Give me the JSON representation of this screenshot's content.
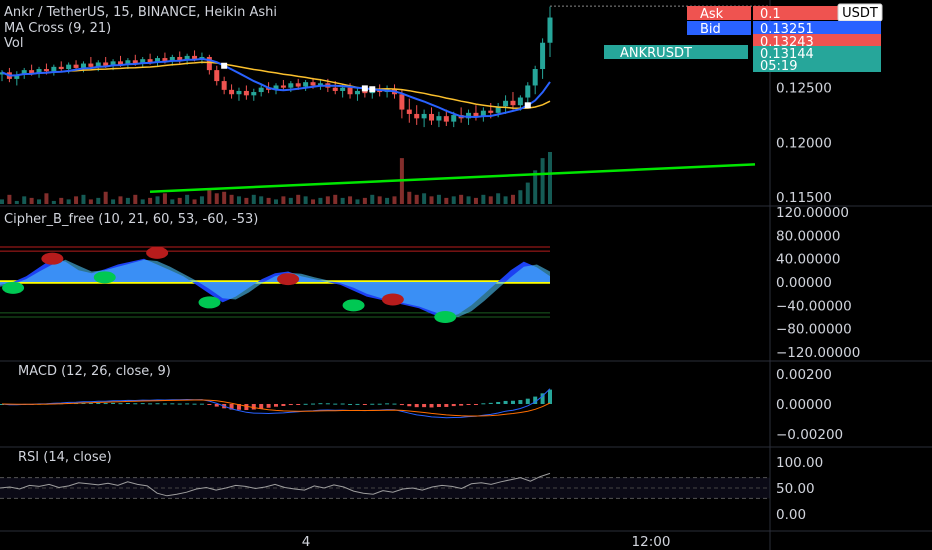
{
  "header": {
    "title": "Ankr / TetherUS, 15, BINANCE, Heikin Ashi",
    "ma_label": "MA Cross (9, 21)",
    "vol_label": "Vol"
  },
  "price_tags": {
    "ask_label": "Ask",
    "ask_value": "0.1",
    "bid_label": "Bid",
    "bid_value": "0.13251",
    "third_value": "0.13243",
    "symbol": "ANKRUSDT",
    "last_price": "0.13144",
    "countdown": "05:19",
    "currency_button": "USDT"
  },
  "colors": {
    "up": "#26a69a",
    "down": "#ef5350",
    "ma_fast": "#2962ff",
    "ma_slow": "#fbc02d",
    "trendline": "#00e600",
    "cipher_fill_yellow": "#ffff00",
    "cipher_fill_blue": "#1e44ff",
    "dot_red": "#b71c1c",
    "dot_green": "#00c853"
  },
  "chart_data": [
    {
      "type": "candlestick",
      "title": "Ankr / TetherUS, 15, BINANCE, Heikin Ashi",
      "y_ticks": [
        "0.12500",
        "0.12000",
        "0.11500"
      ],
      "ylim": [
        0.1142,
        0.133
      ],
      "x_ticks": [
        "4",
        "12:00"
      ],
      "candles": [
        [
          0.1262,
          0.1266,
          0.1256,
          0.1264
        ],
        [
          0.1264,
          0.1268,
          0.1255,
          0.1258
        ],
        [
          0.1258,
          0.1265,
          0.1252,
          0.1262
        ],
        [
          0.1262,
          0.1268,
          0.1258,
          0.1266
        ],
        [
          0.1266,
          0.1271,
          0.1261,
          0.1263
        ],
        [
          0.1263,
          0.1269,
          0.1259,
          0.1267
        ],
        [
          0.1267,
          0.1272,
          0.1262,
          0.1265
        ],
        [
          0.1265,
          0.1271,
          0.1261,
          0.1269
        ],
        [
          0.1269,
          0.1274,
          0.1264,
          0.1267
        ],
        [
          0.1267,
          0.1273,
          0.1263,
          0.1271
        ],
        [
          0.1271,
          0.1275,
          0.1265,
          0.1268
        ],
        [
          0.1268,
          0.1274,
          0.1264,
          0.1272
        ],
        [
          0.1272,
          0.1278,
          0.1266,
          0.1269
        ],
        [
          0.1269,
          0.1275,
          0.1265,
          0.1273
        ],
        [
          0.1273,
          0.1278,
          0.1268,
          0.127
        ],
        [
          0.127,
          0.1276,
          0.1266,
          0.1274
        ],
        [
          0.1274,
          0.1279,
          0.1269,
          0.1271
        ],
        [
          0.1271,
          0.1277,
          0.1267,
          0.1275
        ],
        [
          0.1275,
          0.128,
          0.127,
          0.1272
        ],
        [
          0.1272,
          0.1278,
          0.1268,
          0.1276
        ],
        [
          0.1276,
          0.1281,
          0.1271,
          0.1273
        ],
        [
          0.1273,
          0.1279,
          0.1269,
          0.1277
        ],
        [
          0.1277,
          0.1282,
          0.1272,
          0.1274
        ],
        [
          0.1274,
          0.128,
          0.127,
          0.1278
        ],
        [
          0.1278,
          0.1283,
          0.1272,
          0.1275
        ],
        [
          0.1275,
          0.1281,
          0.1271,
          0.1279
        ],
        [
          0.1279,
          0.1284,
          0.1274,
          0.1276
        ],
        [
          0.1276,
          0.1282,
          0.1272,
          0.1278
        ],
        [
          0.1278,
          0.128,
          0.1262,
          0.1266
        ],
        [
          0.1266,
          0.127,
          0.1252,
          0.1256
        ],
        [
          0.1256,
          0.126,
          0.1244,
          0.1248
        ],
        [
          0.1248,
          0.1253,
          0.124,
          0.1244
        ],
        [
          0.1244,
          0.125,
          0.1238,
          0.1247
        ],
        [
          0.1247,
          0.1252,
          0.1239,
          0.1243
        ],
        [
          0.1243,
          0.1249,
          0.1238,
          0.1246
        ],
        [
          0.1246,
          0.1252,
          0.1242,
          0.125
        ],
        [
          0.125,
          0.1255,
          0.1245,
          0.1248
        ],
        [
          0.1248,
          0.1254,
          0.1244,
          0.1252
        ],
        [
          0.1252,
          0.1257,
          0.1247,
          0.125
        ],
        [
          0.125,
          0.1256,
          0.1246,
          0.1254
        ],
        [
          0.1254,
          0.1258,
          0.1248,
          0.1251
        ],
        [
          0.1251,
          0.1257,
          0.1247,
          0.1255
        ],
        [
          0.1255,
          0.1259,
          0.1249,
          0.1252
        ],
        [
          0.1252,
          0.1258,
          0.1248,
          0.1254
        ],
        [
          0.1254,
          0.1258,
          0.1246,
          0.125
        ],
        [
          0.125,
          0.1256,
          0.1244,
          0.1247
        ],
        [
          0.1247,
          0.1253,
          0.1241,
          0.125
        ],
        [
          0.125,
          0.1254,
          0.124,
          0.1244
        ],
        [
          0.1244,
          0.125,
          0.1238,
          0.1247
        ],
        [
          0.1247,
          0.1252,
          0.1241,
          0.1245
        ],
        [
          0.1245,
          0.1251,
          0.124,
          0.1248
        ],
        [
          0.1248,
          0.1253,
          0.1242,
          0.1246
        ],
        [
          0.1246,
          0.1252,
          0.1241,
          0.1249
        ],
        [
          0.1249,
          0.1253,
          0.124,
          0.1244
        ],
        [
          0.1244,
          0.1248,
          0.1222,
          0.123
        ],
        [
          0.123,
          0.124,
          0.1218,
          0.1226
        ],
        [
          0.1226,
          0.1234,
          0.1216,
          0.1222
        ],
        [
          0.1222,
          0.123,
          0.1214,
          0.1226
        ],
        [
          0.1226,
          0.1232,
          0.1216,
          0.122
        ],
        [
          0.122,
          0.1228,
          0.1214,
          0.1224
        ],
        [
          0.1224,
          0.123,
          0.1215,
          0.1219
        ],
        [
          0.1219,
          0.1228,
          0.1214,
          0.1225
        ],
        [
          0.1225,
          0.1232,
          0.1218,
          0.1222
        ],
        [
          0.1222,
          0.123,
          0.1216,
          0.1227
        ],
        [
          0.1227,
          0.1234,
          0.122,
          0.1224
        ],
        [
          0.1224,
          0.1232,
          0.1219,
          0.1229
        ],
        [
          0.1229,
          0.1236,
          0.1222,
          0.1227
        ],
        [
          0.1227,
          0.1236,
          0.1223,
          0.1233
        ],
        [
          0.1233,
          0.1243,
          0.1226,
          0.1238
        ],
        [
          0.1238,
          0.1246,
          0.123,
          0.1234
        ],
        [
          0.1234,
          0.1243,
          0.1229,
          0.1241
        ],
        [
          0.1241,
          0.1255,
          0.1234,
          0.1252
        ],
        [
          0.1252,
          0.127,
          0.1244,
          0.1267
        ],
        [
          0.1267,
          0.1295,
          0.1258,
          0.1291
        ],
        [
          0.1291,
          0.1324,
          0.1278,
          0.1314
        ]
      ],
      "volume": [
        3,
        6,
        2,
        5,
        4,
        3,
        7,
        2,
        4,
        3,
        5,
        6,
        3,
        4,
        8,
        3,
        5,
        4,
        6,
        3,
        4,
        5,
        7,
        3,
        4,
        6,
        3,
        5,
        9,
        7,
        8,
        6,
        5,
        4,
        6,
        5,
        4,
        3,
        5,
        4,
        6,
        5,
        3,
        4,
        5,
        6,
        4,
        5,
        3,
        4,
        6,
        5,
        4,
        5,
        30,
        8,
        6,
        7,
        5,
        6,
        4,
        5,
        6,
        5,
        4,
        6,
        5,
        7,
        5,
        6,
        9,
        14,
        22,
        30,
        34
      ],
      "trendline_from_to": [
        [
          0.1155,
          0.118
        ]
      ]
    },
    {
      "type": "line",
      "title": "Cipher_B_free (10, 21, 60, 53, -60, -53)",
      "y_ticks": [
        "120.00000",
        "80.00000",
        "40.00000",
        "0.00000",
        "−40.00000",
        "−80.00000",
        "−120.00000"
      ],
      "ylim": [
        -120,
        120
      ],
      "levels": [
        60,
        53,
        -53,
        -60
      ],
      "wave1": [
        -5,
        0,
        10,
        25,
        40,
        35,
        20,
        15,
        22,
        30,
        35,
        40,
        30,
        20,
        10,
        -5,
        -20,
        -35,
        -25,
        -10,
        5,
        15,
        18,
        10,
        5,
        0,
        -5,
        -15,
        -25,
        -30,
        -35,
        -40,
        -45,
        -55,
        -62,
        -55,
        -40,
        -20,
        0,
        20,
        35,
        25,
        10
      ],
      "wave2": [
        -8,
        -4,
        5,
        18,
        30,
        38,
        28,
        18,
        20,
        26,
        32,
        38,
        36,
        26,
        14,
        2,
        -12,
        -28,
        -30,
        -18,
        -2,
        10,
        16,
        14,
        8,
        3,
        -2,
        -10,
        -20,
        -27,
        -32,
        -37,
        -42,
        -50,
        -58,
        -60,
        -50,
        -32,
        -12,
        8,
        26,
        30,
        18
      ],
      "dots": [
        [
          1,
          -10,
          "green"
        ],
        [
          4,
          40,
          "red"
        ],
        [
          8,
          8,
          "green"
        ],
        [
          12,
          50,
          "red"
        ],
        [
          16,
          -35,
          "green"
        ],
        [
          22,
          5,
          "red"
        ],
        [
          27,
          -40,
          "green"
        ],
        [
          30,
          -30,
          "red"
        ],
        [
          34,
          -60,
          "green"
        ]
      ]
    },
    {
      "type": "bar",
      "title": "MACD (12, 26, close, 9)",
      "y_ticks": [
        "0.00200",
        "0.00000",
        "−0.00200"
      ],
      "ylim": [
        -0.0028,
        0.0028
      ]
    },
    {
      "type": "line",
      "title": "RSI (14, close)",
      "y_ticks": [
        "100.00",
        "50.00",
        "0.00"
      ],
      "ylim": [
        0,
        100
      ],
      "values": [
        50,
        52,
        48,
        55,
        53,
        57,
        51,
        54,
        60,
        58,
        56,
        59,
        55,
        62,
        57,
        54,
        40,
        35,
        38,
        42,
        48,
        51,
        46,
        50,
        55,
        53,
        49,
        52,
        57,
        51,
        48,
        46,
        54,
        50,
        56,
        52,
        44,
        40,
        38,
        45,
        42,
        48,
        50,
        46,
        52,
        55,
        53,
        49,
        58,
        60,
        57,
        62,
        66,
        70,
        63,
        72,
        78
      ]
    }
  ]
}
